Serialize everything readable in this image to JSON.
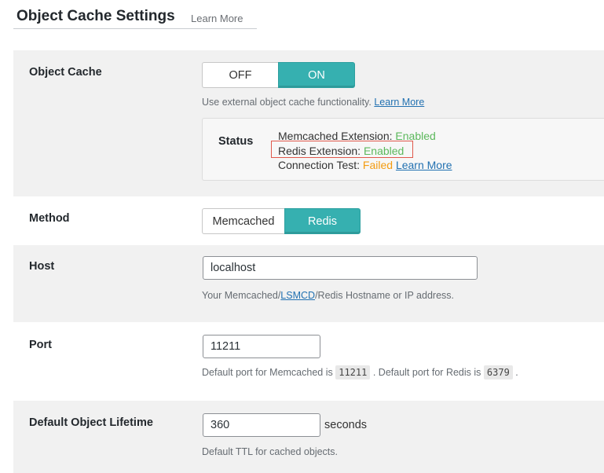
{
  "header": {
    "title": "Object Cache Settings",
    "learn_more": "Learn More"
  },
  "object_cache": {
    "label": "Object Cache",
    "off_label": "OFF",
    "on_label": "ON",
    "selected": "ON",
    "desc": "Use external object cache functionality.",
    "desc_link": "Learn More",
    "status": {
      "label": "Status",
      "memcached_label": "Memcached Extension:",
      "memcached_value": "Enabled",
      "redis_label": "Redis Extension:",
      "redis_value": "Enabled",
      "connection_label": "Connection Test:",
      "connection_value": "Failed",
      "connection_link": "Learn More"
    }
  },
  "method": {
    "label": "Method",
    "option_memcached": "Memcached",
    "option_redis": "Redis",
    "selected": "Redis"
  },
  "host": {
    "label": "Host",
    "value": "localhost",
    "desc_pre": "Your Memcached/",
    "desc_link": "LSMCD",
    "desc_post": "/Redis Hostname or IP address."
  },
  "port": {
    "label": "Port",
    "value": "11211",
    "desc_a": "Default port for Memcached is",
    "memcached_port": "11211",
    "desc_b": ". Default port for Redis is",
    "redis_port": "6379",
    "desc_c": "."
  },
  "lifetime": {
    "label": "Default Object Lifetime",
    "value": "360",
    "suffix": "seconds",
    "desc": "Default TTL for cached objects."
  },
  "colors": {
    "accent": "#36b0b0",
    "enabled": "#5cb85c",
    "failed": "#f39c12",
    "link": "#2271b1",
    "highlight": "#e0594c"
  }
}
